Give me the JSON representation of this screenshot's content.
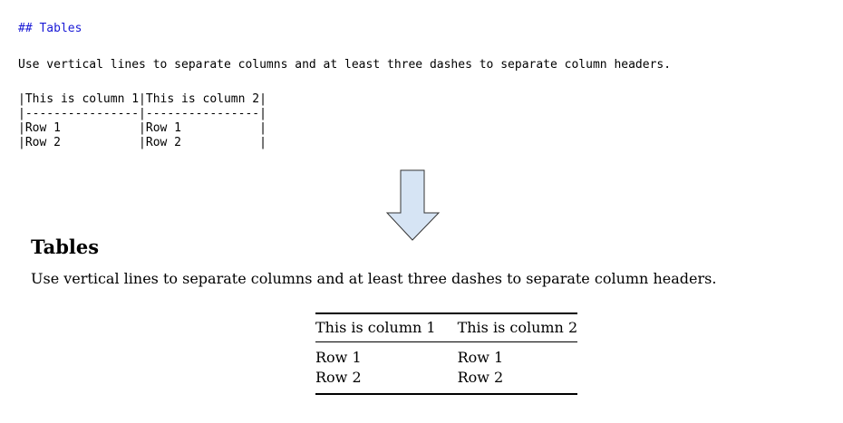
{
  "source": {
    "heading": "## Tables",
    "description": "Use vertical lines to separate columns and at least three dashes to separate column headers.",
    "table_lines": [
      "|This is column 1|This is column 2|",
      "|----------------|----------------|",
      "|Row 1           |Row 1           |",
      "|Row 2           |Row 2           |"
    ]
  },
  "rendered": {
    "title": "Tables",
    "paragraph": "Use vertical lines to separate columns and at least three dashes to separate column headers.",
    "table": {
      "headers": [
        "This is column 1",
        "This is column 2"
      ],
      "rows": [
        [
          "Row 1",
          "Row 1"
        ],
        [
          "Row 2",
          "Row 2"
        ]
      ]
    }
  },
  "colors": {
    "source_heading": "#1a1ad6",
    "arrow_fill": "#d6e4f4"
  },
  "icons": {
    "arrow": "down-arrow-icon"
  }
}
